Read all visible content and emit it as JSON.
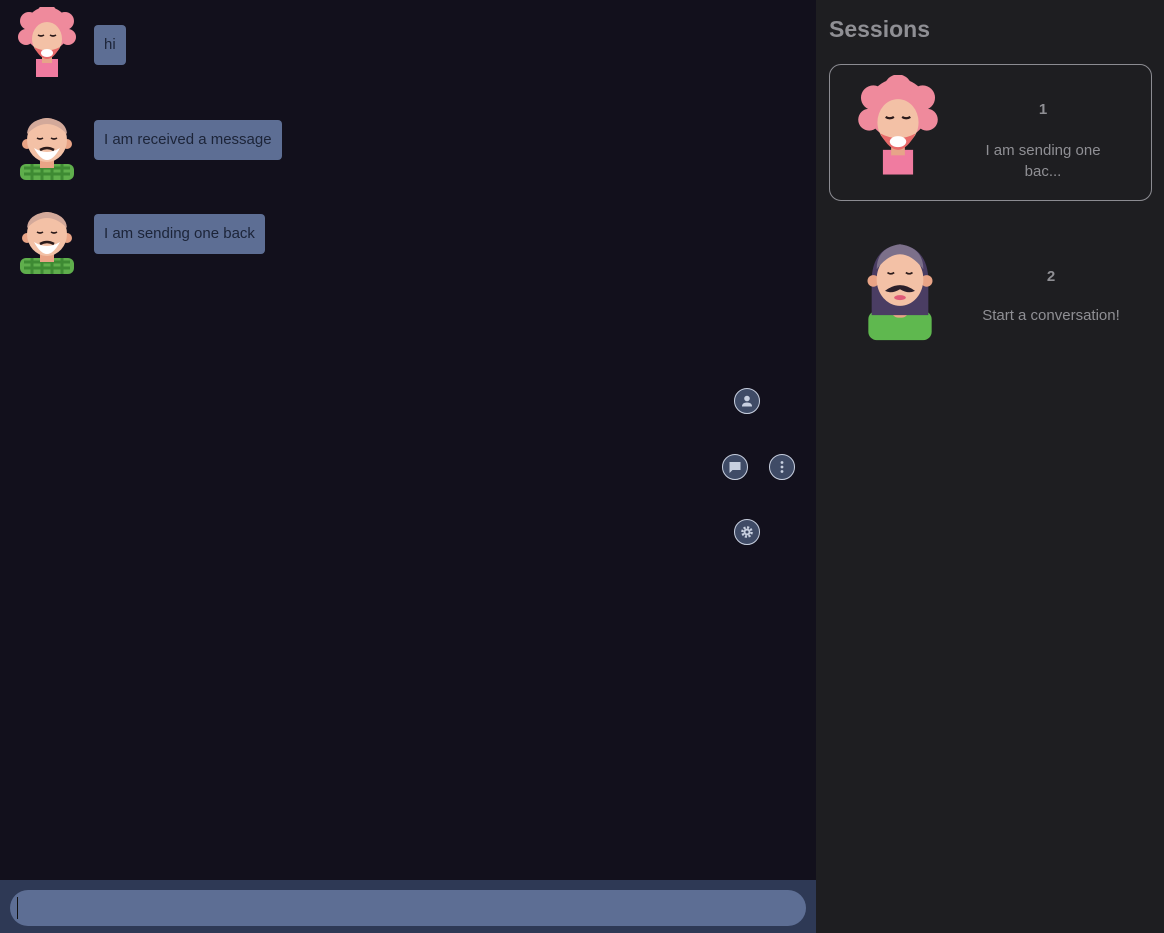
{
  "chat": {
    "messages": [
      {
        "text": "hi",
        "avatar": "pink-curly-hair-avatar"
      },
      {
        "text": "I am received a message",
        "avatar": "bald-bearded-man-avatar"
      },
      {
        "text": "I am sending one back",
        "avatar": "bald-bearded-man-avatar"
      }
    ]
  },
  "fab_menu": {
    "icons": [
      "person-icon",
      "chat-bubble-icon",
      "more-vertical-icon",
      "settings-gear-icon"
    ]
  },
  "composer": {
    "value": "",
    "placeholder": ""
  },
  "sessions": {
    "title": "Sessions",
    "items": [
      {
        "number": "1",
        "preview": "I am sending one bac...",
        "avatar": "pink-curly-hair-avatar",
        "active": true
      },
      {
        "number": "2",
        "preview": "Start a conversation!",
        "avatar": "mustache-long-hair-avatar",
        "active": false
      }
    ]
  },
  "colors": {
    "chat_background": "#12101c",
    "bubble": "#5d6e94",
    "sidebar_background": "#1e1e21",
    "composer_bar": "#2e3955"
  }
}
